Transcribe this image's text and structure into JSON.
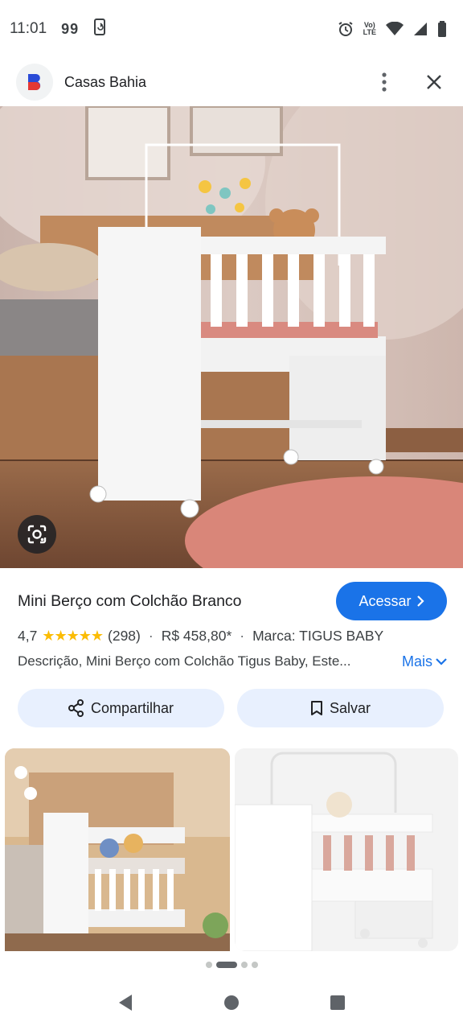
{
  "status_bar": {
    "time": "11:01",
    "notification": "99",
    "volte_top": "Vo)",
    "volte_bottom": "LTE",
    "icons": [
      "screenshot-sync-icon",
      "alarm-icon",
      "volte-icon",
      "wifi-icon",
      "signal-icon",
      "battery-icon"
    ]
  },
  "header": {
    "site_name": "Casas Bahia",
    "logo_letter": "B",
    "brand_color": "#2a4bd7",
    "brand_accent": "#e53935",
    "icons": [
      "more-vert-icon",
      "close-icon"
    ]
  },
  "hero": {
    "icons": [
      "lens-icon"
    ]
  },
  "product": {
    "title": "Mini Berço com Colchão Branco",
    "visit_label": "Acessar",
    "rating": "4,7",
    "stars": "★★★★★",
    "reviews": "(298)",
    "price": "R$ 458,80*",
    "brand": "Marca: TIGUS BABY",
    "description": "Descrição, Mini Berço com Colchão Tigus Baby, Este...",
    "more_label": "Mais"
  },
  "actions": {
    "share_label": "Compartilhar",
    "save_label": "Salvar"
  },
  "pagination": {
    "count": 4,
    "active": 1
  },
  "colors": {
    "accent": "#1a73e8",
    "star": "#fbbc04",
    "pill_bg": "#e8f0fe"
  }
}
